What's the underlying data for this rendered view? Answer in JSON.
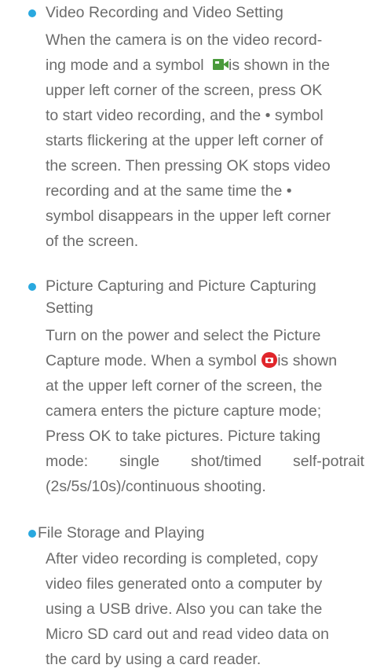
{
  "section1": {
    "title": "Video Recording and Video Setting",
    "l1": "When the camera is on the video record-",
    "l2a": "ing mode and a symbol",
    "l2b": "is shown in the",
    "l3": "upper left corner of the screen, press OK",
    "l4": "to start video recording, and the • symbol",
    "l5": "starts flickering at the upper left corner of",
    "l6": "the screen. Then pressing OK stops video",
    "l7": "recording and at the same time the •",
    "l8": "symbol disappears in the upper left corner",
    "l9": "of the screen."
  },
  "section2": {
    "title": "Picture Capturing and Picture Capturing",
    "title2": "Setting",
    "l1": "Turn on the power and select the Picture",
    "l2a": "Capture mode. When a symbol",
    "l2b": "is shown",
    "l3": "at the upper left corner of the screen, the",
    "l4": "camera enters the picture capture mode;",
    "l5": "Press OK to take pictures. Picture taking",
    "l6_words": [
      "mode:",
      "single",
      "shot/timed",
      "self-potrait"
    ],
    "l7": "(2s/5s/10s)/continuous shooting."
  },
  "section3": {
    "title": "File Storage and Playing",
    "l1": "After video recording is completed, copy",
    "l2": "video files generated onto a computer by",
    "l3": "using a USB drive. Also you can take the",
    "l4": "Micro SD card out and read video data on",
    "l5": "the card by using a card reader."
  },
  "colors": {
    "bullet": "#29a8df",
    "text": "#6b6b6b",
    "video_icon": "#4a9a3c",
    "camera_icon": "#e0262b"
  },
  "icons": {
    "video_mode": "video-camera-icon",
    "photo_mode": "camera-icon"
  }
}
